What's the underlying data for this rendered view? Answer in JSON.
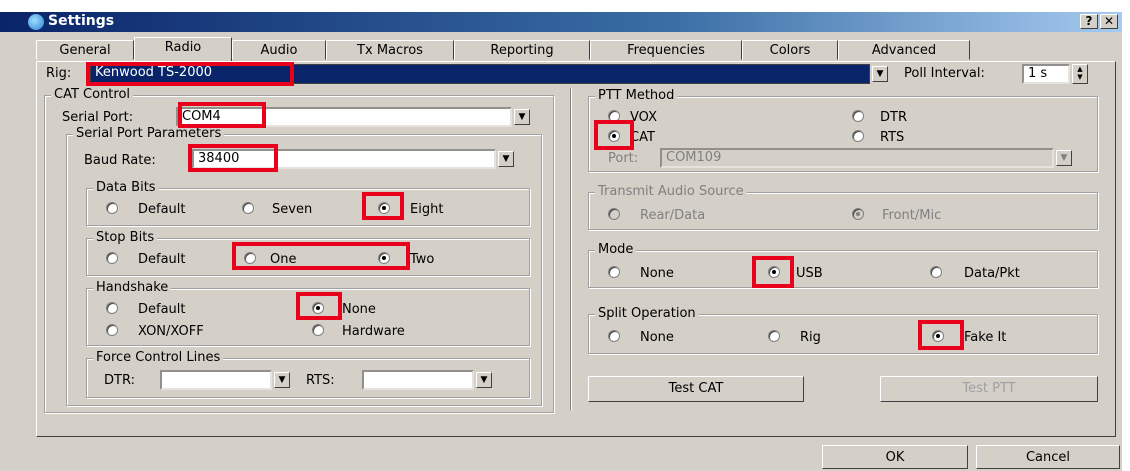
{
  "window": {
    "title": "Settings",
    "help_label": "?",
    "close_label": "✕"
  },
  "tabs": [
    "General",
    "Radio",
    "Audio",
    "Tx Macros",
    "Reporting",
    "Frequencies",
    "Colors",
    "Advanced"
  ],
  "rig": {
    "label": "Rig:",
    "value": "Kenwood TS-2000"
  },
  "poll": {
    "label": "Poll Interval:",
    "value": "1 s"
  },
  "cat": {
    "title": "CAT Control",
    "serial_port_label": "Serial Port:",
    "serial_port": "COM4",
    "params_title": "Serial Port Parameters",
    "baud_label": "Baud Rate:",
    "baud": "38400",
    "data_bits": {
      "title": "Data Bits",
      "options": [
        "Default",
        "Seven",
        "Eight"
      ],
      "selected": "Eight"
    },
    "stop_bits": {
      "title": "Stop Bits",
      "options": [
        "Default",
        "One",
        "Two"
      ],
      "selected": "Two"
    },
    "handshake": {
      "title": "Handshake",
      "options": [
        "Default",
        "None",
        "XON/XOFF",
        "Hardware"
      ],
      "selected": "None"
    },
    "force": {
      "title": "Force Control Lines",
      "dtr_label": "DTR:",
      "dtr": "",
      "rts_label": "RTS:",
      "rts": ""
    }
  },
  "ptt": {
    "title": "PTT Method",
    "options": [
      "VOX",
      "DTR",
      "CAT",
      "RTS"
    ],
    "selected": "CAT",
    "port_label": "Port:",
    "port": "COM109"
  },
  "tx_audio": {
    "title": "Transmit Audio Source",
    "options": [
      "Rear/Data",
      "Front/Mic"
    ],
    "selected": "Front/Mic"
  },
  "mode": {
    "title": "Mode",
    "options": [
      "None",
      "USB",
      "Data/Pkt"
    ],
    "selected": "USB"
  },
  "split": {
    "title": "Split Operation",
    "options": [
      "None",
      "Rig",
      "Fake It"
    ],
    "selected": "Fake It"
  },
  "buttons": {
    "test_cat": "Test CAT",
    "test_ptt": "Test PTT",
    "ok": "OK",
    "cancel": "Cancel"
  },
  "colors": {
    "titlebar": "#0a246a",
    "face": "#d4d0c8",
    "selection": "#0a246a",
    "annotation": "#e8001c"
  }
}
